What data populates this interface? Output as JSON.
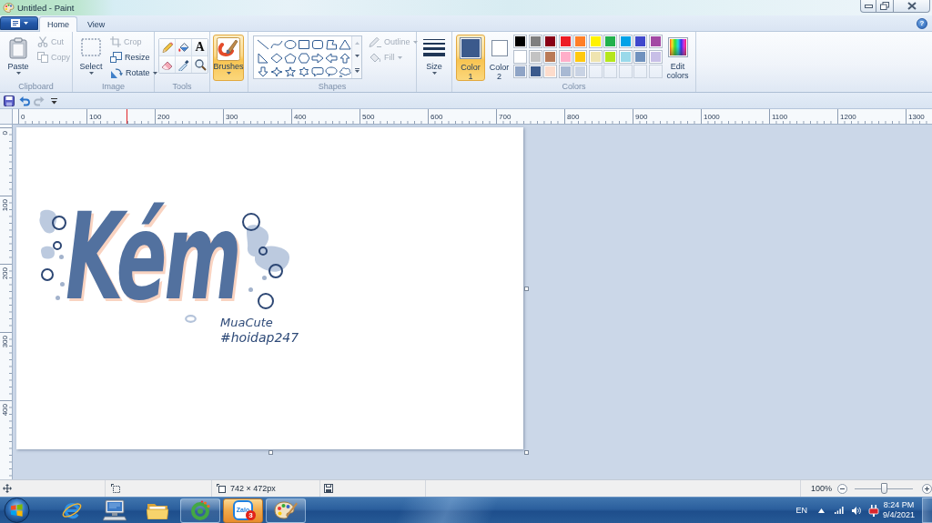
{
  "window": {
    "title": "Untitled - Paint"
  },
  "ribbon_tabs": [
    {
      "label": "Home",
      "selected": true
    },
    {
      "label": "View",
      "selected": false
    }
  ],
  "help_button": "?",
  "clipboard": {
    "label": "Clipboard",
    "paste": "Paste",
    "actions": [
      {
        "kind": "cut",
        "label": "Cut",
        "disabled": true
      },
      {
        "kind": "copy",
        "label": "Copy",
        "disabled": true
      }
    ]
  },
  "image": {
    "label": "Image",
    "select": "Select",
    "actions": [
      {
        "kind": "crop",
        "label": "Crop",
        "disabled": true
      },
      {
        "kind": "resize",
        "label": "Resize",
        "disabled": false
      },
      {
        "kind": "rotate",
        "label": "Rotate",
        "disabled": false
      }
    ]
  },
  "tools": {
    "label": "Tools",
    "text_tool": "A"
  },
  "brushes": {
    "label": "Brushes",
    "selected": true
  },
  "shapes": {
    "label": "Shapes",
    "options": [
      {
        "kind": "outline",
        "label": "Outline",
        "disabled": true
      },
      {
        "kind": "fill",
        "label": "Fill",
        "disabled": true
      }
    ]
  },
  "size": {
    "label": "Size"
  },
  "colors": {
    "label": "Colors",
    "color_1": {
      "label": "Color 1",
      "color": "#3b5a8c",
      "selected": true
    },
    "color_2": {
      "label": "Color 2",
      "color": "#ffffff",
      "selected": false
    },
    "palette": [
      [
        {
          "color": "#000000"
        },
        {
          "color": "#7f7f7f"
        },
        {
          "color": "#880015"
        },
        {
          "color": "#ed1c24"
        },
        {
          "color": "#ff7f27"
        },
        {
          "color": "#fff200"
        },
        {
          "color": "#22b14c"
        },
        {
          "color": "#00a2e8"
        },
        {
          "color": "#3f48cc"
        },
        {
          "color": "#a349a4"
        }
      ],
      [
        {
          "color": "#ffffff"
        },
        {
          "color": "#c3c3c3"
        },
        {
          "color": "#b97a57"
        },
        {
          "color": "#ffaec9"
        },
        {
          "color": "#ffc90e"
        },
        {
          "color": "#efe4b0"
        },
        {
          "color": "#b5e61d"
        },
        {
          "color": "#99d9ea"
        },
        {
          "color": "#7092be"
        },
        {
          "color": "#c8bfe7"
        }
      ],
      [
        {
          "color": "#8fa4c6"
        },
        {
          "color": "#3b5a8c"
        },
        {
          "color": "#fddccc"
        },
        {
          "color": "#a8b9d3"
        },
        {
          "color": "#c9d3e4"
        }
      ]
    ],
    "edit_colors": "Edit colors"
  },
  "quick_access": [
    {
      "kind": "save",
      "disabled": false
    },
    {
      "kind": "undo",
      "disabled": false
    },
    {
      "kind": "redo",
      "disabled": true
    },
    {
      "kind": "customize",
      "disabled": false
    }
  ],
  "ruler": {
    "horizontal": [
      "0",
      "100",
      "200",
      "300",
      "400",
      "500",
      "600",
      "700",
      "800",
      "900",
      "1000",
      "1100",
      "1200",
      "1300"
    ],
    "vertical": [
      "0",
      "100",
      "200",
      "300",
      "400"
    ],
    "cursor_marker": {
      "level": 0.124
    }
  },
  "canvas": {
    "lettering": "Kém",
    "signature": [
      "MuaCute",
      "#hoidap247"
    ]
  },
  "status_bar": {
    "image_size": "742 × 472px",
    "zoom": "100%",
    "zoom_slider": {
      "level": 0.5
    }
  },
  "taskbar": {
    "apps": [
      {
        "kind": "browser",
        "running": false,
        "flashing": false
      },
      {
        "kind": "computer",
        "running": false,
        "flashing": false
      },
      {
        "kind": "folder",
        "running": false,
        "flashing": false
      },
      {
        "kind": "ring",
        "running": true,
        "flashing": false
      },
      {
        "kind": "chat",
        "running": true,
        "flashing": true,
        "logo_text": "Zalo",
        "badge": "3"
      },
      {
        "kind": "paint",
        "running": true,
        "flashing": false
      }
    ],
    "tray": {
      "language": "EN",
      "time": "8:24 PM",
      "date": "9/4/2021"
    }
  }
}
